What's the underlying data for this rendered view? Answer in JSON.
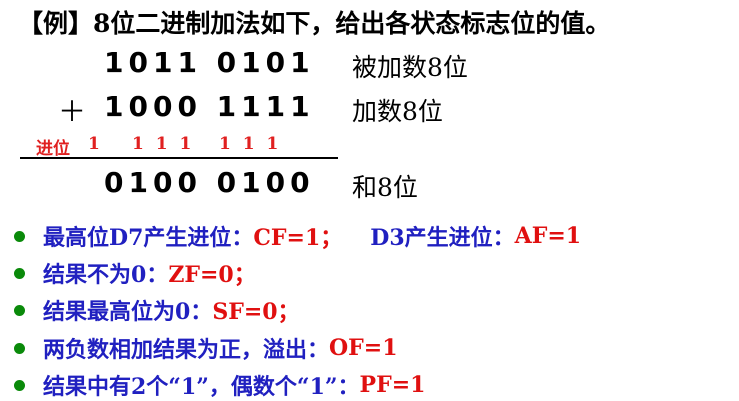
{
  "title": "【例】8位二进制加法如下，给出各状态标志位的值。",
  "addend1": {
    "bits": "1011 0101",
    "label": "被加数8位"
  },
  "addend2": {
    "sign": "＋",
    "bits": "1000 1111",
    "label": "加数8位"
  },
  "carry": {
    "label": "进位",
    "d7": "1",
    "d5d4d3": "1 1 1",
    "d2d1d0": "1 1 1"
  },
  "result": {
    "bits": "0100 0100",
    "label": "和8位"
  },
  "bullets": [
    {
      "lead": "最高位D7产生进位：",
      "flag": "CF=1；",
      "lead2": "D3产生进位：",
      "flag2": "AF=1"
    },
    {
      "lead": "结果不为0：",
      "flag": "ZF=0；"
    },
    {
      "lead": "结果最高位为0：",
      "flag": "SF=0；"
    },
    {
      "lead": "两负数相加结果为正，溢出：",
      "flag": "OF=1"
    },
    {
      "lead": "结果中有2个“1”，偶数个“1”：",
      "flag": "PF=1"
    }
  ],
  "colors": {
    "bullet": "#0a8a0a",
    "lead": "#2020c0",
    "flag": "#e01010",
    "carry": "#e02020"
  }
}
